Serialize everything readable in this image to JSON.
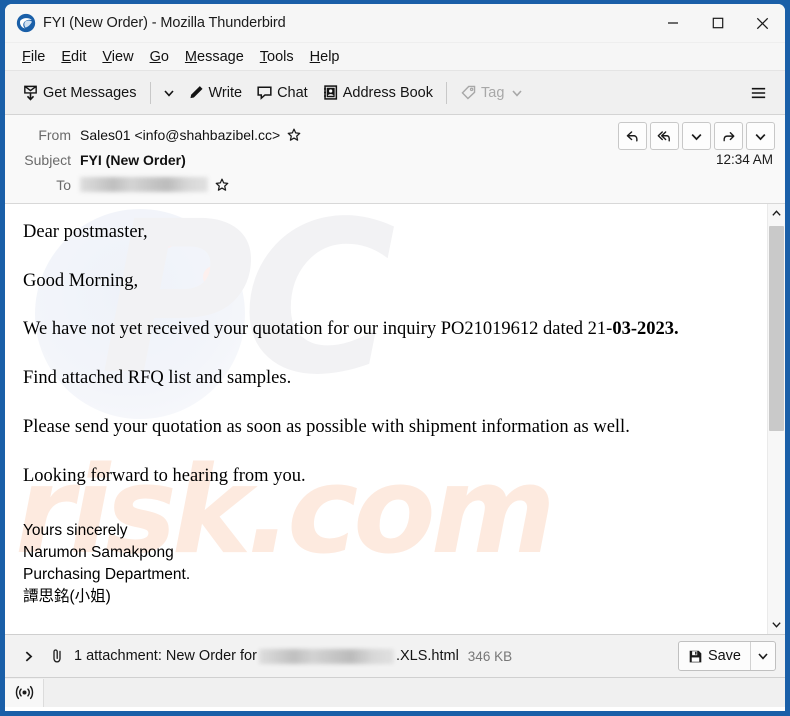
{
  "window": {
    "title": "FYI (New Order) - Mozilla Thunderbird",
    "logo_icon": "thunderbird-logo-icon",
    "controls": {
      "minimize": "minimize-icon",
      "maximize": "maximize-icon",
      "close": "close-icon"
    },
    "frame_color": "#1a5fa8"
  },
  "menubar": {
    "items": [
      {
        "label": "File",
        "accel": "F"
      },
      {
        "label": "Edit",
        "accel": "E"
      },
      {
        "label": "View",
        "accel": "V"
      },
      {
        "label": "Go",
        "accel": "G"
      },
      {
        "label": "Message",
        "accel": "M"
      },
      {
        "label": "Tools",
        "accel": "T"
      },
      {
        "label": "Help",
        "accel": "H"
      }
    ]
  },
  "toolbar": {
    "get_messages_label": "Get Messages",
    "get_messages_icon": "get-messages-icon",
    "get_messages_caret": "chevron-down-icon",
    "write_label": "Write",
    "write_icon": "pencil-icon",
    "chat_label": "Chat",
    "chat_icon": "chat-bubble-icon",
    "address_book_label": "Address Book",
    "address_book_icon": "address-book-icon",
    "tag_label": "Tag",
    "tag_icon": "tag-icon",
    "tag_caret": "chevron-down-icon",
    "tag_disabled": true,
    "app_menu_icon": "hamburger-menu-icon"
  },
  "message_header": {
    "from_label": "From",
    "from_value": "Sales01 <info@shahbazibel.cc>",
    "from_star_icon": "star-icon",
    "subject_label": "Subject",
    "subject_value": "FYI (New Order)",
    "time": "12:34 AM",
    "to_label": "To",
    "to_value_redacted": true,
    "to_star_icon": "star-icon",
    "actions": [
      {
        "name": "reply-button",
        "icon": "reply-arrow-icon"
      },
      {
        "name": "reply-all-button",
        "icon": "reply-all-arrow-icon"
      },
      {
        "name": "reply-options-button",
        "icon": "chevron-down-icon"
      },
      {
        "name": "forward-button",
        "icon": "forward-arrow-icon"
      },
      {
        "name": "more-actions-button",
        "icon": "chevron-down-icon"
      }
    ]
  },
  "message_body": {
    "paragraphs": [
      {
        "text": "Dear postmaster,",
        "bold_tail": ""
      },
      {
        "text": "Good Morning,",
        "bold_tail": ""
      },
      {
        "text": "We have not yet received your quotation for our inquiry PO21019612 dated 21-",
        "bold_tail": "03-2023."
      },
      {
        "text": "Find attached RFQ list and samples.",
        "bold_tail": ""
      },
      {
        "text": "Please send your quotation as soon as possible with shipment information as well.",
        "bold_tail": ""
      },
      {
        "text": "Looking forward to hearing from you.",
        "bold_tail": ""
      }
    ],
    "signature": [
      "Yours sincerely",
      "Narumon Samakpong",
      "Purchasing Department.",
      "譚思銘(小姐)"
    ],
    "watermark": {
      "primary": "PC",
      "secondary": "risk.com",
      "primary_color": "#f2f2f4",
      "secondary_color": "#fdeadf"
    }
  },
  "scrollbar": {
    "up_icon": "chevron-up-icon",
    "down_icon": "chevron-down-icon"
  },
  "attachment_bar": {
    "expand_icon": "chevron-right-icon",
    "clip_icon": "paperclip-icon",
    "text_prefix": "1 attachment: New Order for ",
    "filename_redacted": true,
    "text_suffix": ".XLS.html",
    "size": "346 KB",
    "save_label": "Save",
    "save_icon": "save-disk-icon",
    "save_caret_icon": "chevron-down-icon"
  },
  "statusbar": {
    "icon": "broadcast-signal-icon"
  }
}
